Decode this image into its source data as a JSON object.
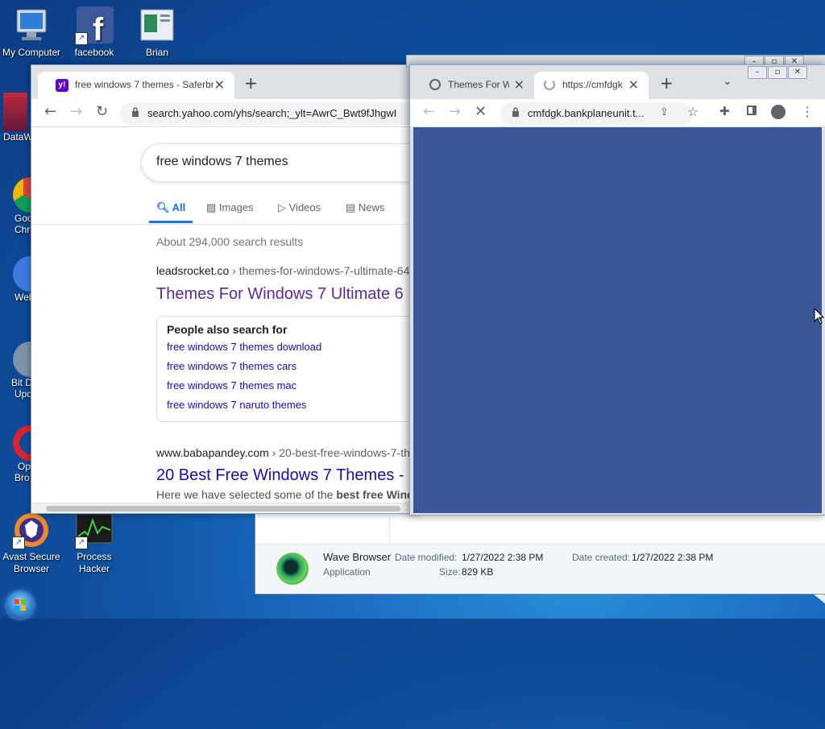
{
  "desktop": {
    "icons": [
      {
        "label": "My Computer"
      },
      {
        "label": "facebook"
      },
      {
        "label": "Brian"
      },
      {
        "label": "Avast Secure Browser"
      },
      {
        "label": "Process Hacker"
      }
    ],
    "partial_labels": [
      "DataW",
      "Goo",
      "Chr",
      "Wel",
      "Bit D",
      "Upd",
      "Op",
      "Bro"
    ]
  },
  "explorer": {
    "file_name": "Wave Browser",
    "file_type": "Application",
    "date_modified_label": "Date modified:",
    "date_modified_value": "1/27/2022 2:38 PM",
    "date_created_label": "Date created:",
    "date_created_value": "1/27/2022 2:38 PM",
    "size_label": "Size:",
    "size_value": "829 KB"
  },
  "browser_left": {
    "tab_title": "free windows 7 themes - Saferbr",
    "url": "search.yahoo.com/yhs/search;_ylt=AwrC_Bwt9fJhgwI",
    "query": "free windows 7 themes",
    "tabs": [
      "All",
      "Images",
      "Videos",
      "News"
    ],
    "result_count": "About 294,000 search results",
    "results": [
      {
        "domain": "leadsrocket.co",
        "path": " › themes-for-windows-7-ultimate-64",
        "title": "Themes For Windows 7 Ultimate 6"
      },
      {
        "domain": "www.babapandey.com",
        "path": " › 20-best-free-windows-7-th",
        "title": "20 Best Free Windows 7 Themes -"
      }
    ],
    "people_also_search": {
      "heading": "People also search for",
      "links": [
        "free windows 7 themes download",
        "free windows 7 themes cars",
        "free windows 7 themes mac",
        "free windows 7 naruto themes"
      ]
    },
    "snippet_prefix": "Here we have selected some of the ",
    "snippet_bold": "best free Windo"
  },
  "browser_right": {
    "tab1_title": "Themes For W",
    "tab2_title": "https://cmfdgk",
    "url": "cmfdgk.bankplaneunit.t...",
    "page_color": "#3a5598"
  }
}
